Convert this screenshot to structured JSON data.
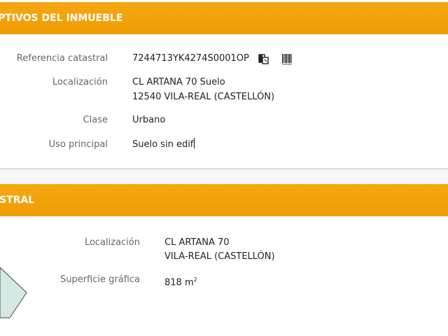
{
  "section1": {
    "header": "PTIVOS DEL INMUEBLE",
    "rows": {
      "ref_label": "Referencia catastral",
      "ref_value": "7244713YK4274S0001OP",
      "loc_label": "Localización",
      "loc_line1": "CL ARTANA 70 Suelo",
      "loc_line2": "12540 VILA-REAL (CASTELLÓN)",
      "clase_label": "Clase",
      "clase_value": "Urbano",
      "uso_label": "Uso principal",
      "uso_value": "Suelo sin edif"
    },
    "icons": [
      "copy-icon",
      "barcode-icon"
    ]
  },
  "section2": {
    "header": "STRAL",
    "rows": {
      "loc_label": "Localización",
      "loc_line1": "CL ARTANA 70",
      "loc_line2": "VILA-REAL (CASTELLÓN)",
      "sup_label": "Superficie gráfica",
      "sup_value": "818 m",
      "sup_unit_exp": "2"
    },
    "parcel_color": "#d4e8e4"
  },
  "colors": {
    "header_bg": "#f2a20a",
    "label": "#666666",
    "value": "#222222"
  }
}
